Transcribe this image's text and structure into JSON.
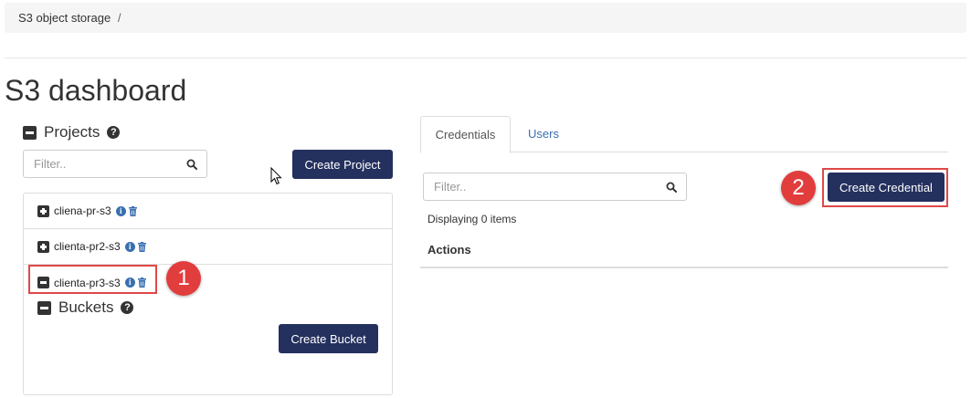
{
  "breadcrumb": {
    "item": "S3 object storage",
    "separator": "/"
  },
  "page": {
    "title": "S3 dashboard"
  },
  "projects": {
    "heading": "Projects",
    "filter_placeholder": "Filter..",
    "create_label": "Create Project",
    "items": [
      {
        "name": "cliena-pr-s3",
        "expanded": false
      },
      {
        "name": "clienta-pr2-s3",
        "expanded": false
      },
      {
        "name": "clienta-pr3-s3",
        "expanded": true
      }
    ],
    "buckets": {
      "heading": "Buckets",
      "create_label": "Create Bucket"
    }
  },
  "tabs": [
    {
      "label": "Credentials",
      "active": true
    },
    {
      "label": "Users",
      "active": false
    }
  ],
  "credentials": {
    "filter_placeholder": "Filter..",
    "create_label": "Create Credential",
    "displaying": "Displaying 0 items",
    "columns": [
      "Actions"
    ]
  },
  "callouts": [
    "1",
    "2"
  ],
  "colors": {
    "primary_button": "#24305e",
    "link": "#3a70b0",
    "callout": "#e23d3d",
    "highlight_border": "#e04848"
  }
}
